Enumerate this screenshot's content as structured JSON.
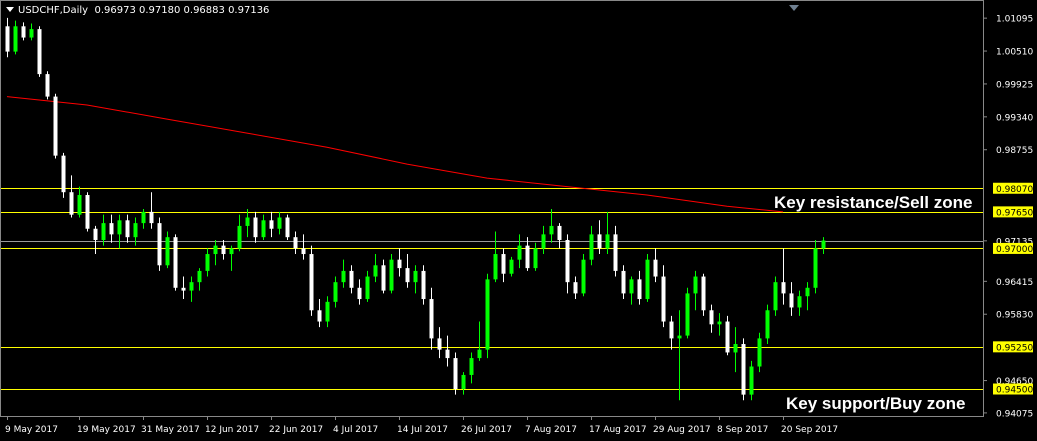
{
  "header": {
    "symbol": "USDCHF,Daily",
    "ohlc": "0.96973 0.97180 0.96883 0.97136"
  },
  "annotations": {
    "resistance": "Key resistance/Sell zone",
    "support": "Key support/Buy zone"
  },
  "colors": {
    "background": "#000000",
    "bull_candle": "#00ff00",
    "bear_candle": "#ffffff",
    "moving_average": "#ff0000",
    "level_line": "#ffff00",
    "axis_text": "#ffffff",
    "price_label_bg": "#ffff00",
    "price_label_text": "#000000"
  },
  "chart_data": {
    "type": "candlestick",
    "ylim": [
      0.9402,
      1.014
    ],
    "y_ticks": [
      "1.01095",
      "1.00510",
      "0.99925",
      "0.99340",
      "0.98755",
      "0.98070",
      "0.97650",
      "0.97135",
      "0.97000",
      "0.96415",
      "0.95830",
      "0.95250",
      "0.94650",
      "0.94500",
      "0.94075"
    ],
    "x_ticks": [
      {
        "label": "9 May 2017",
        "index": 0
      },
      {
        "label": "19 May 2017",
        "index": 9
      },
      {
        "label": "31 May 2017",
        "index": 17
      },
      {
        "label": "12 Jun 2017",
        "index": 25
      },
      {
        "label": "22 Jun 2017",
        "index": 33
      },
      {
        "label": "4 Jul 2017",
        "index": 41
      },
      {
        "label": "14 Jul 2017",
        "index": 49
      },
      {
        "label": "26 Jul 2017",
        "index": 57
      },
      {
        "label": "7 Aug 2017",
        "index": 65
      },
      {
        "label": "17 Aug 2017",
        "index": 73
      },
      {
        "label": "29 Aug 2017",
        "index": 81
      },
      {
        "label": "8 Sep 2017",
        "index": 89
      },
      {
        "label": "20 Sep 2017",
        "index": 97
      }
    ],
    "horizontal_levels": [
      {
        "value": 0.9807,
        "label": "0.98070"
      },
      {
        "value": 0.9765,
        "label": "0.97650"
      },
      {
        "value": 0.97,
        "label": "0.97000"
      },
      {
        "value": 0.9525,
        "label": "0.95250"
      },
      {
        "value": 0.945,
        "label": "0.94500"
      }
    ],
    "current_price": {
      "value": 0.97136,
      "label": "0.97136"
    },
    "moving_average": [
      [
        0,
        0.997
      ],
      [
        10,
        0.9955
      ],
      [
        20,
        0.993
      ],
      [
        30,
        0.9905
      ],
      [
        40,
        0.988
      ],
      [
        50,
        0.985
      ],
      [
        60,
        0.9825
      ],
      [
        70,
        0.981
      ],
      [
        80,
        0.9795
      ],
      [
        90,
        0.9775
      ],
      [
        97,
        0.9765
      ]
    ],
    "candles": [
      [
        1.0095,
        1.011,
        1.004,
        1.005
      ],
      [
        1.005,
        1.0105,
        1.0045,
        1.0095
      ],
      [
        1.0095,
        1.0102,
        1.007,
        1.0075
      ],
      [
        1.0075,
        1.01,
        1.007,
        1.009
      ],
      [
        1.009,
        1.0095,
        1.0005,
        1.001
      ],
      [
        1.001,
        1.0015,
        0.9965,
        0.997
      ],
      [
        0.997,
        0.9975,
        0.986,
        0.9865
      ],
      [
        0.9865,
        0.987,
        0.979,
        0.98
      ],
      [
        0.98,
        0.983,
        0.9755,
        0.976
      ],
      [
        0.976,
        0.981,
        0.9755,
        0.9795
      ],
      [
        0.9795,
        0.98,
        0.973,
        0.9735
      ],
      [
        0.9735,
        0.974,
        0.969,
        0.9715
      ],
      [
        0.9715,
        0.976,
        0.9705,
        0.9745
      ],
      [
        0.9745,
        0.976,
        0.971,
        0.9725
      ],
      [
        0.9725,
        0.976,
        0.97,
        0.975
      ],
      [
        0.975,
        0.976,
        0.971,
        0.972
      ],
      [
        0.972,
        0.9755,
        0.9705,
        0.9745
      ],
      [
        0.9745,
        0.977,
        0.9735,
        0.9765
      ],
      [
        0.9765,
        0.98,
        0.9735,
        0.9745
      ],
      [
        0.9745,
        0.9755,
        0.966,
        0.967
      ],
      [
        0.967,
        0.973,
        0.9665,
        0.972
      ],
      [
        0.972,
        0.9725,
        0.9625,
        0.963
      ],
      [
        0.963,
        0.965,
        0.961,
        0.9625
      ],
      [
        0.9625,
        0.965,
        0.9605,
        0.964
      ],
      [
        0.964,
        0.9665,
        0.9625,
        0.966
      ],
      [
        0.966,
        0.97,
        0.965,
        0.969
      ],
      [
        0.969,
        0.9715,
        0.967,
        0.9705
      ],
      [
        0.9705,
        0.9715,
        0.968,
        0.969
      ],
      [
        0.969,
        0.9705,
        0.966,
        0.97
      ],
      [
        0.97,
        0.976,
        0.9695,
        0.974
      ],
      [
        0.974,
        0.977,
        0.972,
        0.9755
      ],
      [
        0.9755,
        0.9765,
        0.971,
        0.972
      ],
      [
        0.972,
        0.976,
        0.9715,
        0.975
      ],
      [
        0.975,
        0.9765,
        0.972,
        0.9735
      ],
      [
        0.9735,
        0.9765,
        0.9725,
        0.9755
      ],
      [
        0.9755,
        0.976,
        0.9715,
        0.972
      ],
      [
        0.972,
        0.973,
        0.969,
        0.97
      ],
      [
        0.97,
        0.9725,
        0.968,
        0.969
      ],
      [
        0.969,
        0.9705,
        0.958,
        0.959
      ],
      [
        0.959,
        0.961,
        0.956,
        0.957
      ],
      [
        0.957,
        0.9615,
        0.956,
        0.9605
      ],
      [
        0.9605,
        0.965,
        0.9595,
        0.964
      ],
      [
        0.964,
        0.968,
        0.963,
        0.966
      ],
      [
        0.966,
        0.967,
        0.962,
        0.963
      ],
      [
        0.963,
        0.9645,
        0.96,
        0.961
      ],
      [
        0.961,
        0.966,
        0.9605,
        0.965
      ],
      [
        0.965,
        0.969,
        0.964,
        0.967
      ],
      [
        0.967,
        0.968,
        0.962,
        0.9625
      ],
      [
        0.9625,
        0.969,
        0.962,
        0.968
      ],
      [
        0.968,
        0.97,
        0.965,
        0.9665
      ],
      [
        0.9665,
        0.969,
        0.963,
        0.964
      ],
      [
        0.964,
        0.967,
        0.962,
        0.966
      ],
      [
        0.966,
        0.967,
        0.96,
        0.961
      ],
      [
        0.961,
        0.963,
        0.952,
        0.954
      ],
      [
        0.954,
        0.956,
        0.9505,
        0.952
      ],
      [
        0.952,
        0.9545,
        0.949,
        0.9505
      ],
      [
        0.9505,
        0.9515,
        0.944,
        0.945
      ],
      [
        0.945,
        0.948,
        0.944,
        0.9475
      ],
      [
        0.9475,
        0.9515,
        0.946,
        0.9505
      ],
      [
        0.9505,
        0.957,
        0.95,
        0.952
      ],
      [
        0.952,
        0.9655,
        0.9505,
        0.9645
      ],
      [
        0.9645,
        0.973,
        0.964,
        0.969
      ],
      [
        0.969,
        0.97,
        0.964,
        0.9655
      ],
      [
        0.9655,
        0.9685,
        0.965,
        0.968
      ],
      [
        0.968,
        0.9725,
        0.9665,
        0.9705
      ],
      [
        0.9705,
        0.972,
        0.966,
        0.9665
      ],
      [
        0.9665,
        0.971,
        0.966,
        0.97
      ],
      [
        0.97,
        0.974,
        0.969,
        0.9725
      ],
      [
        0.9725,
        0.977,
        0.971,
        0.974
      ],
      [
        0.974,
        0.9745,
        0.97,
        0.9715
      ],
      [
        0.9715,
        0.9725,
        0.962,
        0.964
      ],
      [
        0.964,
        0.965,
        0.961,
        0.962
      ],
      [
        0.962,
        0.969,
        0.9615,
        0.968
      ],
      [
        0.968,
        0.974,
        0.967,
        0.9725
      ],
      [
        0.9725,
        0.975,
        0.969,
        0.97
      ],
      [
        0.97,
        0.9765,
        0.969,
        0.9725
      ],
      [
        0.9725,
        0.974,
        0.965,
        0.966
      ],
      [
        0.966,
        0.967,
        0.961,
        0.962
      ],
      [
        0.962,
        0.965,
        0.96,
        0.9645
      ],
      [
        0.9645,
        0.966,
        0.96,
        0.961
      ],
      [
        0.961,
        0.969,
        0.9605,
        0.968
      ],
      [
        0.968,
        0.97,
        0.964,
        0.965
      ],
      [
        0.965,
        0.967,
        0.956,
        0.957
      ],
      [
        0.957,
        0.958,
        0.952,
        0.954
      ],
      [
        0.954,
        0.959,
        0.943,
        0.9545
      ],
      [
        0.9545,
        0.963,
        0.954,
        0.962
      ],
      [
        0.962,
        0.966,
        0.959,
        0.965
      ],
      [
        0.965,
        0.9655,
        0.958,
        0.959
      ],
      [
        0.959,
        0.96,
        0.955,
        0.9565
      ],
      [
        0.9565,
        0.9585,
        0.9545,
        0.957
      ],
      [
        0.957,
        0.958,
        0.951,
        0.9515
      ],
      [
        0.9515,
        0.956,
        0.948,
        0.953
      ],
      [
        0.953,
        0.954,
        0.943,
        0.944
      ],
      [
        0.944,
        0.95,
        0.943,
        0.949
      ],
      [
        0.949,
        0.955,
        0.948,
        0.954
      ],
      [
        0.954,
        0.96,
        0.953,
        0.959
      ],
      [
        0.959,
        0.965,
        0.958,
        0.964
      ],
      [
        0.964,
        0.97,
        0.96,
        0.962
      ],
      [
        0.962,
        0.964,
        0.958,
        0.9595
      ],
      [
        0.9595,
        0.9625,
        0.958,
        0.9615
      ],
      [
        0.9615,
        0.964,
        0.959,
        0.963
      ],
      [
        0.963,
        0.9715,
        0.962,
        0.97
      ],
      [
        0.97,
        0.972,
        0.969,
        0.9714
      ]
    ]
  }
}
